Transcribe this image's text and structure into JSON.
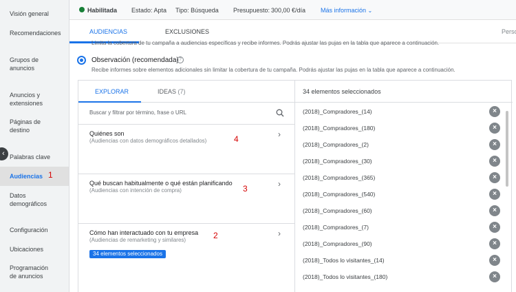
{
  "sidebar": {
    "items": [
      {
        "label": "Visión general"
      },
      {
        "label": "Recomendaciones"
      },
      {
        "label": "Grupos de anuncios"
      },
      {
        "label": "Anuncios y extensiones"
      },
      {
        "label": "Páginas de destino"
      },
      {
        "label": "Palabras clave"
      },
      {
        "label": "Audiencias"
      },
      {
        "label": "Datos demográficos"
      },
      {
        "label": "Configuración"
      },
      {
        "label": "Ubicaciones"
      },
      {
        "label": "Programación de anuncios"
      }
    ],
    "active_annotation": "1",
    "collapse_icon": "chevron-left-icon"
  },
  "statusbar": {
    "status": "Habilitada",
    "estado": "Estado: Apta",
    "tipo": "Tipo: Búsqueda",
    "presupuesto_label": "Presupuesto:",
    "presupuesto_value": "300,00 €/día",
    "more": "Más información",
    "status_color": "#188038"
  },
  "tabs": {
    "audiencias": "AUDIENCIAS",
    "exclusiones": "EXCLUSIONES",
    "right_cut": "Perso"
  },
  "targeting": {
    "cutoff_text": "Limita la cobertura de tu campaña a audiencias específicas y recibe informes. Podrás ajustar las pujas en la tabla que aparece a continuación.",
    "observation_label": "Observación (recomendada)",
    "observation_desc": "Recibe informes sobre elementos adicionales sin limitar la cobertura de tu campaña. Podrás ajustar las pujas en la tabla que aparece a continuación."
  },
  "browse": {
    "tab_explorar": "EXPLORAR",
    "tab_ideas": "IDEAS",
    "ideas_count": "(7)",
    "search_placeholder": "Buscar y filtrar por término, frase o URL",
    "categories": [
      {
        "title": "Quiénes son",
        "sub": "(Audiencias con datos demográficos detallados)",
        "annotation": "4"
      },
      {
        "title": "Qué buscan habitualmente o qué están planificando",
        "sub": "(Audiencias con intención de compra)",
        "annotation": "3"
      },
      {
        "title": "Cómo han interactuado con tu empresa",
        "sub": "(Audiencias de remarketing y similares)",
        "annotation": "2",
        "chip": "34 elementos seleccionados"
      }
    ]
  },
  "selected": {
    "header": "34 elementos seleccionados",
    "items": [
      "(2018)_Compradores_(14)",
      "(2018)_Compradores_(180)",
      "(2018)_Compradores_(2)",
      "(2018)_Compradores_(30)",
      "(2018)_Compradores_(365)",
      "(2018)_Compradores_(540)",
      "(2018)_Compradores_(60)",
      "(2018)_Compradores_(7)",
      "(2018)_Compradores_(90)",
      "(2018)_Todos lo visitantes_(14)",
      "(2018)_Todos lo visitantes_(180)"
    ]
  },
  "colors": {
    "accent": "#1a73e8",
    "annotation": "#d50000"
  }
}
